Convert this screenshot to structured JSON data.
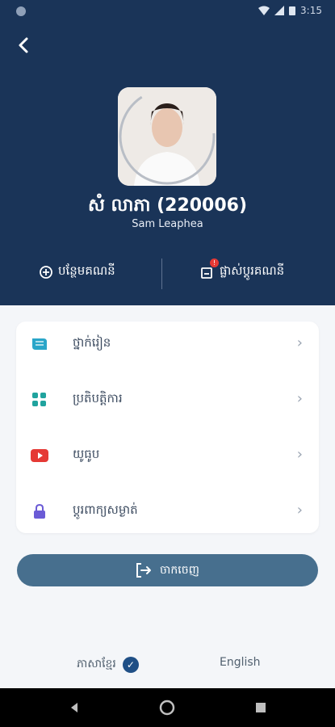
{
  "status": {
    "time": "3:15"
  },
  "profile": {
    "name_kh": "សំ លាភា (220006)",
    "name_en": "Sam Leaphea"
  },
  "actions": {
    "add_account": "បន្ថែមគណនី",
    "switch_account": "ផ្លាស់ប្ដូរគណនី",
    "switch_badge": "!"
  },
  "menu": {
    "items": [
      {
        "label": "ថ្នាក់រៀន",
        "icon": "book-icon",
        "color": "#2aa6c9"
      },
      {
        "label": "ប្រតិបត្តិការ",
        "icon": "grid-icon",
        "color": "#20a39e"
      },
      {
        "label": "យូធូប",
        "icon": "youtube-icon",
        "color": "#e53935"
      },
      {
        "label": "ប្ដូរពាក្យសម្ងាត់",
        "icon": "lock-icon",
        "color": "#6b5bd6"
      }
    ]
  },
  "logout": {
    "label": "ចាកចេញ"
  },
  "language": {
    "khmer": "ភាសាខ្មែរ",
    "english": "English"
  },
  "colors": {
    "header": "#1a3458",
    "button": "#476f8e",
    "background": "#f4f6f9"
  }
}
